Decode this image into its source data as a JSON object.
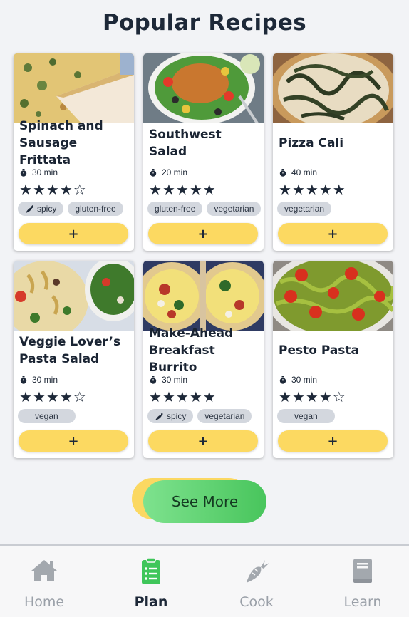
{
  "page": {
    "title": "Popular Recipes"
  },
  "recipes": [
    {
      "title": "Spinach and Sausage Frittata",
      "time": "30 min",
      "rating": 4,
      "tags": [
        {
          "label": "spicy",
          "icon": "chili-icon"
        },
        {
          "label": "gluten-free"
        }
      ],
      "add_label": "+"
    },
    {
      "title": "Southwest Salad",
      "time": "20 min",
      "rating": 5,
      "tags": [
        {
          "label": "gluten-free"
        },
        {
          "label": "vegetarian"
        }
      ],
      "add_label": "+"
    },
    {
      "title": "Pizza Cali",
      "time": "40 min",
      "rating": 5,
      "tags": [
        {
          "label": "vegetarian"
        }
      ],
      "add_label": "+"
    },
    {
      "title": "Veggie Lover’s Pasta Salad",
      "time": "30 min",
      "rating": 4,
      "tags": [
        {
          "label": "vegan"
        }
      ],
      "add_label": "+"
    },
    {
      "title": "Make-Ahead Breakfast Burrito",
      "time": "30 min",
      "rating": 5,
      "tags": [
        {
          "label": "spicy",
          "icon": "chili-icon"
        },
        {
          "label": "vegetarian"
        }
      ],
      "add_label": "+"
    },
    {
      "title": "Pesto Pasta",
      "time": "30 min",
      "rating": 4,
      "tags": [
        {
          "label": "vegan"
        }
      ],
      "add_label": "+"
    }
  ],
  "see_more": {
    "label": "See More"
  },
  "nav": {
    "items": [
      {
        "label": "Home",
        "icon": "home-icon",
        "active": false
      },
      {
        "label": "Plan",
        "icon": "clipboard-list-icon",
        "active": true
      },
      {
        "label": "Cook",
        "icon": "carrot-icon",
        "active": false
      },
      {
        "label": "Learn",
        "icon": "book-icon",
        "active": false
      }
    ]
  },
  "colors": {
    "accent_yellow": "#fcd961",
    "accent_green": "#48c55c",
    "text_dark": "#1d2838",
    "nav_inactive": "#9aa0a8",
    "tag_bg": "#d3d7de"
  }
}
